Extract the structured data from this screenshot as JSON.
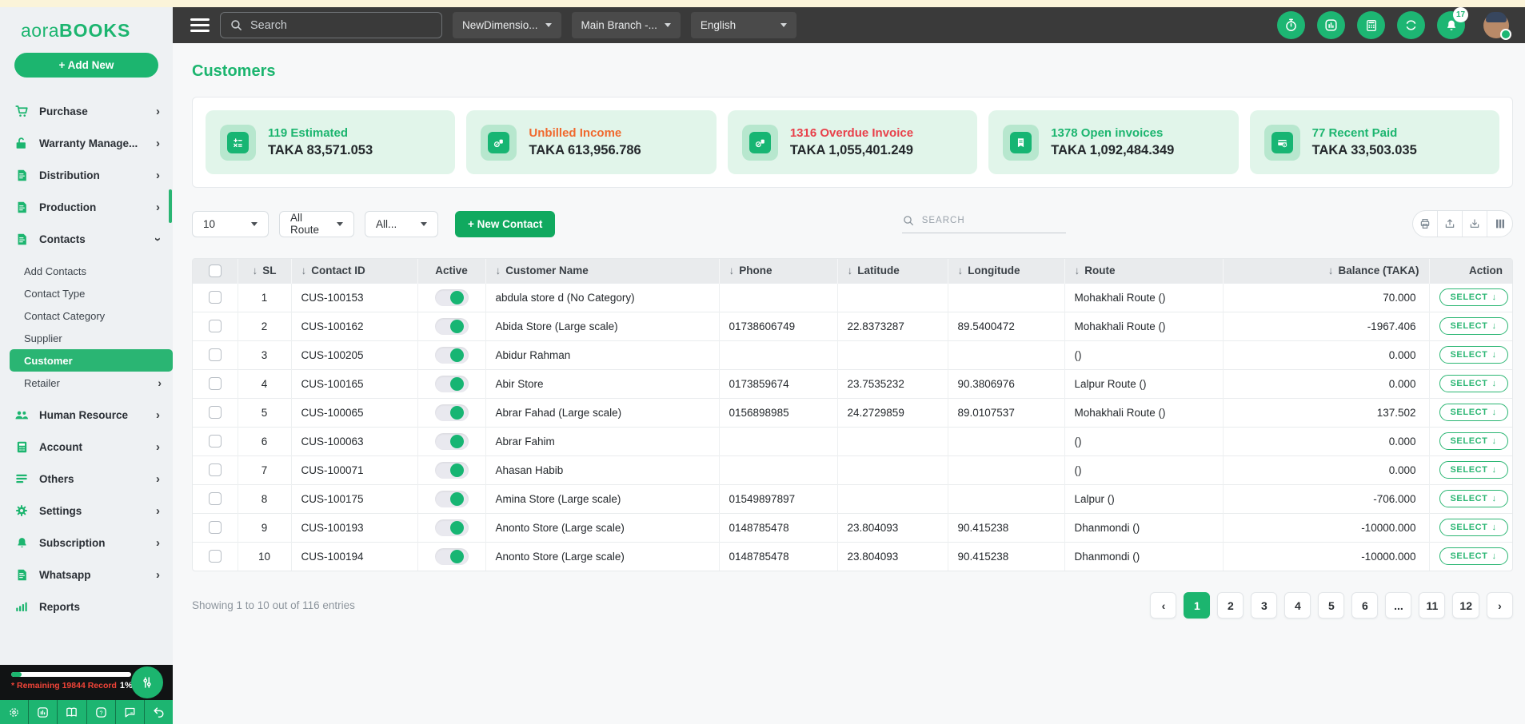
{
  "colors": {
    "primary_green": "#1cb56f",
    "orange": "#f0692e",
    "red": "#e8404a",
    "navbar_bg": "#3a3a3a",
    "cream_strip": "#fbf4d9",
    "card_bg": "#e1f5ea"
  },
  "brand": {
    "logo_prefix": "aora",
    "logo_suffix": "BOOKS"
  },
  "sidebar": {
    "add_new": "+ Add New",
    "menu_upper": [
      {
        "icon": "cart-icon",
        "label": "Purchase"
      },
      {
        "icon": "unlock-icon",
        "label": "Warranty Manage..."
      },
      {
        "icon": "doc-icon",
        "label": "Distribution"
      },
      {
        "icon": "doc-icon",
        "label": "Production"
      },
      {
        "icon": "doc-icon",
        "label": "Contacts"
      }
    ],
    "contacts_submenu": [
      {
        "label": "Add Contacts",
        "active": false,
        "chevron": ""
      },
      {
        "label": "Contact Type",
        "active": false,
        "chevron": ""
      },
      {
        "label": "Contact Category",
        "active": false,
        "chevron": ""
      },
      {
        "label": "Supplier",
        "active": false,
        "chevron": ""
      },
      {
        "label": "Customer",
        "active": true,
        "chevron": ""
      },
      {
        "label": "Retailer",
        "active": false,
        "chevron": "›"
      }
    ],
    "menu_lower": [
      {
        "icon": "people-icon",
        "label": "Human Resource"
      },
      {
        "icon": "calculator-icon",
        "label": "Account"
      },
      {
        "icon": "menu-lines-icon",
        "label": "Others"
      },
      {
        "icon": "gear-icon",
        "label": "Settings"
      },
      {
        "icon": "bell-icon",
        "label": "Subscription"
      },
      {
        "icon": "doc-icon",
        "label": "Whatsapp"
      },
      {
        "icon": "bar-chart-icon",
        "label": "Reports"
      }
    ],
    "usage": {
      "remaining_label": "* Remaining 19844 Record",
      "percent": "1%"
    },
    "bottom_icons": [
      "gear-icon",
      "chart-icon",
      "book-icon",
      "help-icon",
      "chat-icon",
      "undo-icon"
    ]
  },
  "topbar": {
    "search_placeholder": "Search",
    "dropdowns": [
      {
        "label": "NewDimensio..."
      },
      {
        "label": "Main Branch -..."
      },
      {
        "label": "English"
      }
    ],
    "icons": [
      "timer-icon",
      "chart-icon",
      "calculator-icon",
      "scan-icon",
      "bell-icon"
    ],
    "notification_count": "17"
  },
  "page": {
    "title": "Customers"
  },
  "summary_cards": [
    {
      "icon": "calc-icon",
      "title": "119 Estimated",
      "value": "TAKA 83,571.053",
      "title_color": "#1cb56f"
    },
    {
      "icon": "coins-icon",
      "title": "Unbilled Income",
      "value": "TAKA 613,956.786",
      "title_color": "#f0692e"
    },
    {
      "icon": "coins-icon",
      "title": "1316 Overdue Invoice",
      "value": "TAKA 1,055,401.249",
      "title_color": "#e8404a"
    },
    {
      "icon": "invoice-icon",
      "title": "1378 Open invoices",
      "value": "TAKA 1,092,484.349",
      "title_color": "#1cb56f"
    },
    {
      "icon": "card-icon",
      "title": "77 Recent Paid",
      "value": "TAKA 33,503.035",
      "title_color": "#1cb56f"
    }
  ],
  "toolbar": {
    "page_size": "10",
    "route_filter": "All Route",
    "category_filter": "All...",
    "new_contact": "+ New Contact",
    "search_placeholder": "SEARCH",
    "action_icons": [
      "print-icon",
      "export-icon",
      "download-icon",
      "columns-icon"
    ]
  },
  "table": {
    "headers": [
      {
        "label": "SL",
        "sortable": true
      },
      {
        "label": "Contact ID",
        "sortable": true
      },
      {
        "label": "Active",
        "sortable": false
      },
      {
        "label": "Customer Name",
        "sortable": true
      },
      {
        "label": "Phone",
        "sortable": true
      },
      {
        "label": "Latitude",
        "sortable": true
      },
      {
        "label": "Longitude",
        "sortable": true
      },
      {
        "label": "Route",
        "sortable": true
      },
      {
        "label": "Balance (TAKA)",
        "sortable": true
      },
      {
        "label": "Action",
        "sortable": false
      }
    ],
    "select_label": "SELECT",
    "rows": [
      {
        "sl": "1",
        "contact_id": "CUS-100153",
        "customer": "abdula store d (No Category)",
        "phone": "",
        "lat": "",
        "lng": "",
        "route": "Mohakhali Route ()",
        "balance": "70.000"
      },
      {
        "sl": "2",
        "contact_id": "CUS-100162",
        "customer": "Abida Store (Large scale)",
        "phone": "01738606749",
        "lat": "22.8373287",
        "lng": "89.5400472",
        "route": "Mohakhali Route ()",
        "balance": "-1967.406"
      },
      {
        "sl": "3",
        "contact_id": "CUS-100205",
        "customer": "Abidur Rahman",
        "phone": "",
        "lat": "",
        "lng": "",
        "route": "()",
        "balance": "0.000"
      },
      {
        "sl": "4",
        "contact_id": "CUS-100165",
        "customer": "Abir Store",
        "phone": "0173859674",
        "lat": "23.7535232",
        "lng": "90.3806976",
        "route": "Lalpur Route ()",
        "balance": "0.000"
      },
      {
        "sl": "5",
        "contact_id": "CUS-100065",
        "customer": "Abrar Fahad (Large scale)",
        "phone": "0156898985",
        "lat": "24.2729859",
        "lng": "89.0107537",
        "route": "Mohakhali Route ()",
        "balance": "137.502"
      },
      {
        "sl": "6",
        "contact_id": "CUS-100063",
        "customer": "Abrar Fahim",
        "phone": "",
        "lat": "",
        "lng": "",
        "route": "()",
        "balance": "0.000"
      },
      {
        "sl": "7",
        "contact_id": "CUS-100071",
        "customer": "Ahasan Habib",
        "phone": "",
        "lat": "",
        "lng": "",
        "route": "()",
        "balance": "0.000"
      },
      {
        "sl": "8",
        "contact_id": "CUS-100175",
        "customer": "Amina Store (Large scale)",
        "phone": "01549897897",
        "lat": "",
        "lng": "",
        "route": "Lalpur ()",
        "balance": "-706.000"
      },
      {
        "sl": "9",
        "contact_id": "CUS-100193",
        "customer": "Anonto Store (Large scale)",
        "phone": "0148785478",
        "lat": "23.804093",
        "lng": "90.415238",
        "route": "Dhanmondi ()",
        "balance": "-10000.000"
      },
      {
        "sl": "10",
        "contact_id": "CUS-100194",
        "customer": "Anonto Store (Large scale)",
        "phone": "0148785478",
        "lat": "23.804093",
        "lng": "90.415238",
        "route": "Dhanmondi ()",
        "balance": "-10000.000"
      }
    ],
    "footer": {
      "showing": "Showing 1 to 10 out of 116 entries"
    },
    "pagination": [
      {
        "label": "‹",
        "active": false
      },
      {
        "label": "1",
        "active": true
      },
      {
        "label": "2",
        "active": false
      },
      {
        "label": "3",
        "active": false
      },
      {
        "label": "4",
        "active": false
      },
      {
        "label": "5",
        "active": false
      },
      {
        "label": "6",
        "active": false
      },
      {
        "label": "...",
        "active": false
      },
      {
        "label": "11",
        "active": false
      },
      {
        "label": "12",
        "active": false
      },
      {
        "label": "›",
        "active": false
      }
    ]
  }
}
